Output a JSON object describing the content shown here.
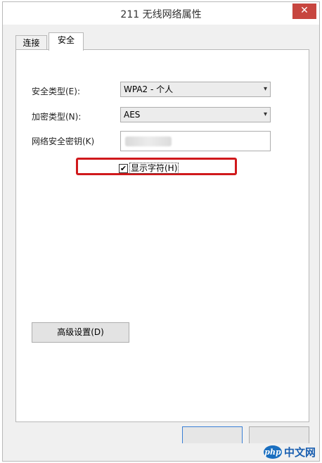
{
  "window": {
    "title": "211 无线网络属性",
    "close_glyph": "✕"
  },
  "tabs": [
    {
      "label": "连接"
    },
    {
      "label": "安全"
    }
  ],
  "security": {
    "security_type_label": "安全类型(E):",
    "security_type_value": "WPA2 - 个人",
    "encryption_type_label": "加密类型(N):",
    "encryption_type_value": "AES",
    "network_key_label": "网络安全密钥(K)",
    "show_chars_label": "显示字符(H)",
    "show_chars_checked": true,
    "check_glyph": "✔",
    "dropdown_glyph": "▾",
    "advanced_button": "高级设置(D)"
  },
  "watermark": {
    "logo_text": "php",
    "site_text": "中文网"
  },
  "colors": {
    "highlight": "#d0191c",
    "close_button": "#c7463f",
    "watermark": "#1a6fc0"
  }
}
